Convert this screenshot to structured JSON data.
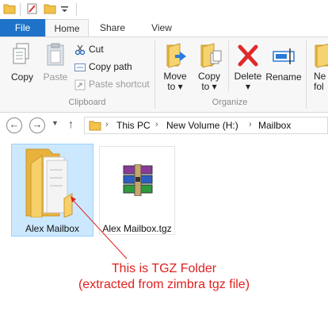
{
  "tabs": {
    "file": "File",
    "home": "Home",
    "share": "Share",
    "view": "View"
  },
  "clipboard": {
    "copy": "Copy",
    "paste": "Paste",
    "cut": "Cut",
    "copy_path": "Copy path",
    "paste_shortcut": "Paste shortcut",
    "group_label": "Clipboard"
  },
  "organize": {
    "move_to": "Move",
    "move_to_2": "to",
    "copy_to": "Copy",
    "copy_to_2": "to",
    "delete": "Delete",
    "rename": "Rename",
    "group_label": "Organize"
  },
  "new_group": {
    "new_folder": "Ne",
    "new_folder_2": "fol"
  },
  "breadcrumb": [
    "This PC",
    "New Volume (H:)",
    "Mailbox"
  ],
  "files": [
    {
      "name": "Alex Mailbox",
      "kind": "folder",
      "selected": true
    },
    {
      "name": "Alex Mailbox.tgz",
      "kind": "archive",
      "selected": false
    }
  ],
  "annotation": {
    "line1": "This is TGZ Folder",
    "line2": "(extracted from zimbra tgz file)"
  },
  "colors": {
    "file_tab": "#1e73c8",
    "selection": "#cce8ff",
    "annotation": "#e0201f",
    "folder": "#f2c24b"
  }
}
